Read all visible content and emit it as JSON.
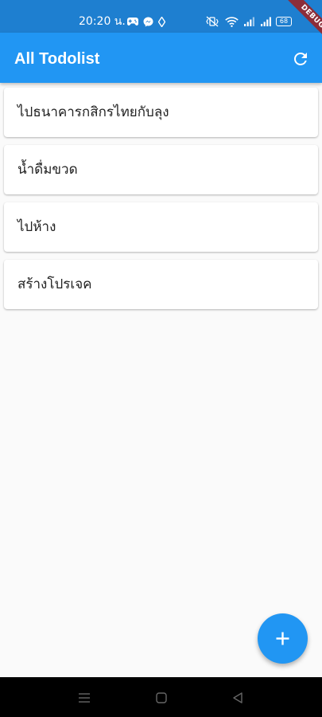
{
  "status_bar": {
    "time": "20:20 น.",
    "battery": "68",
    "left_icons": [
      "gamepad-icon",
      "messenger-icon",
      "location-icon"
    ],
    "right_icons": [
      "mute-vibrate-icon",
      "wifi-icon",
      "signal-icon",
      "signal-icon"
    ]
  },
  "debug_banner": "DEBUG",
  "app_bar": {
    "title": "All Todolist",
    "action_icon": "refresh-icon"
  },
  "todos": [
    {
      "label": "ไปธนาคารกสิกรไทยกับลุง"
    },
    {
      "label": "น้ำดื่มขวด"
    },
    {
      "label": "ไปห้าง"
    },
    {
      "label": "สร้างโปรเจค"
    }
  ],
  "fab": {
    "icon": "add-icon"
  },
  "nav_bar": {
    "icons": [
      "menu-icon",
      "home-icon",
      "back-icon"
    ]
  },
  "colors": {
    "primary": "#2196f3",
    "status_bar": "#1e7fd0",
    "background": "#fafafa"
  }
}
